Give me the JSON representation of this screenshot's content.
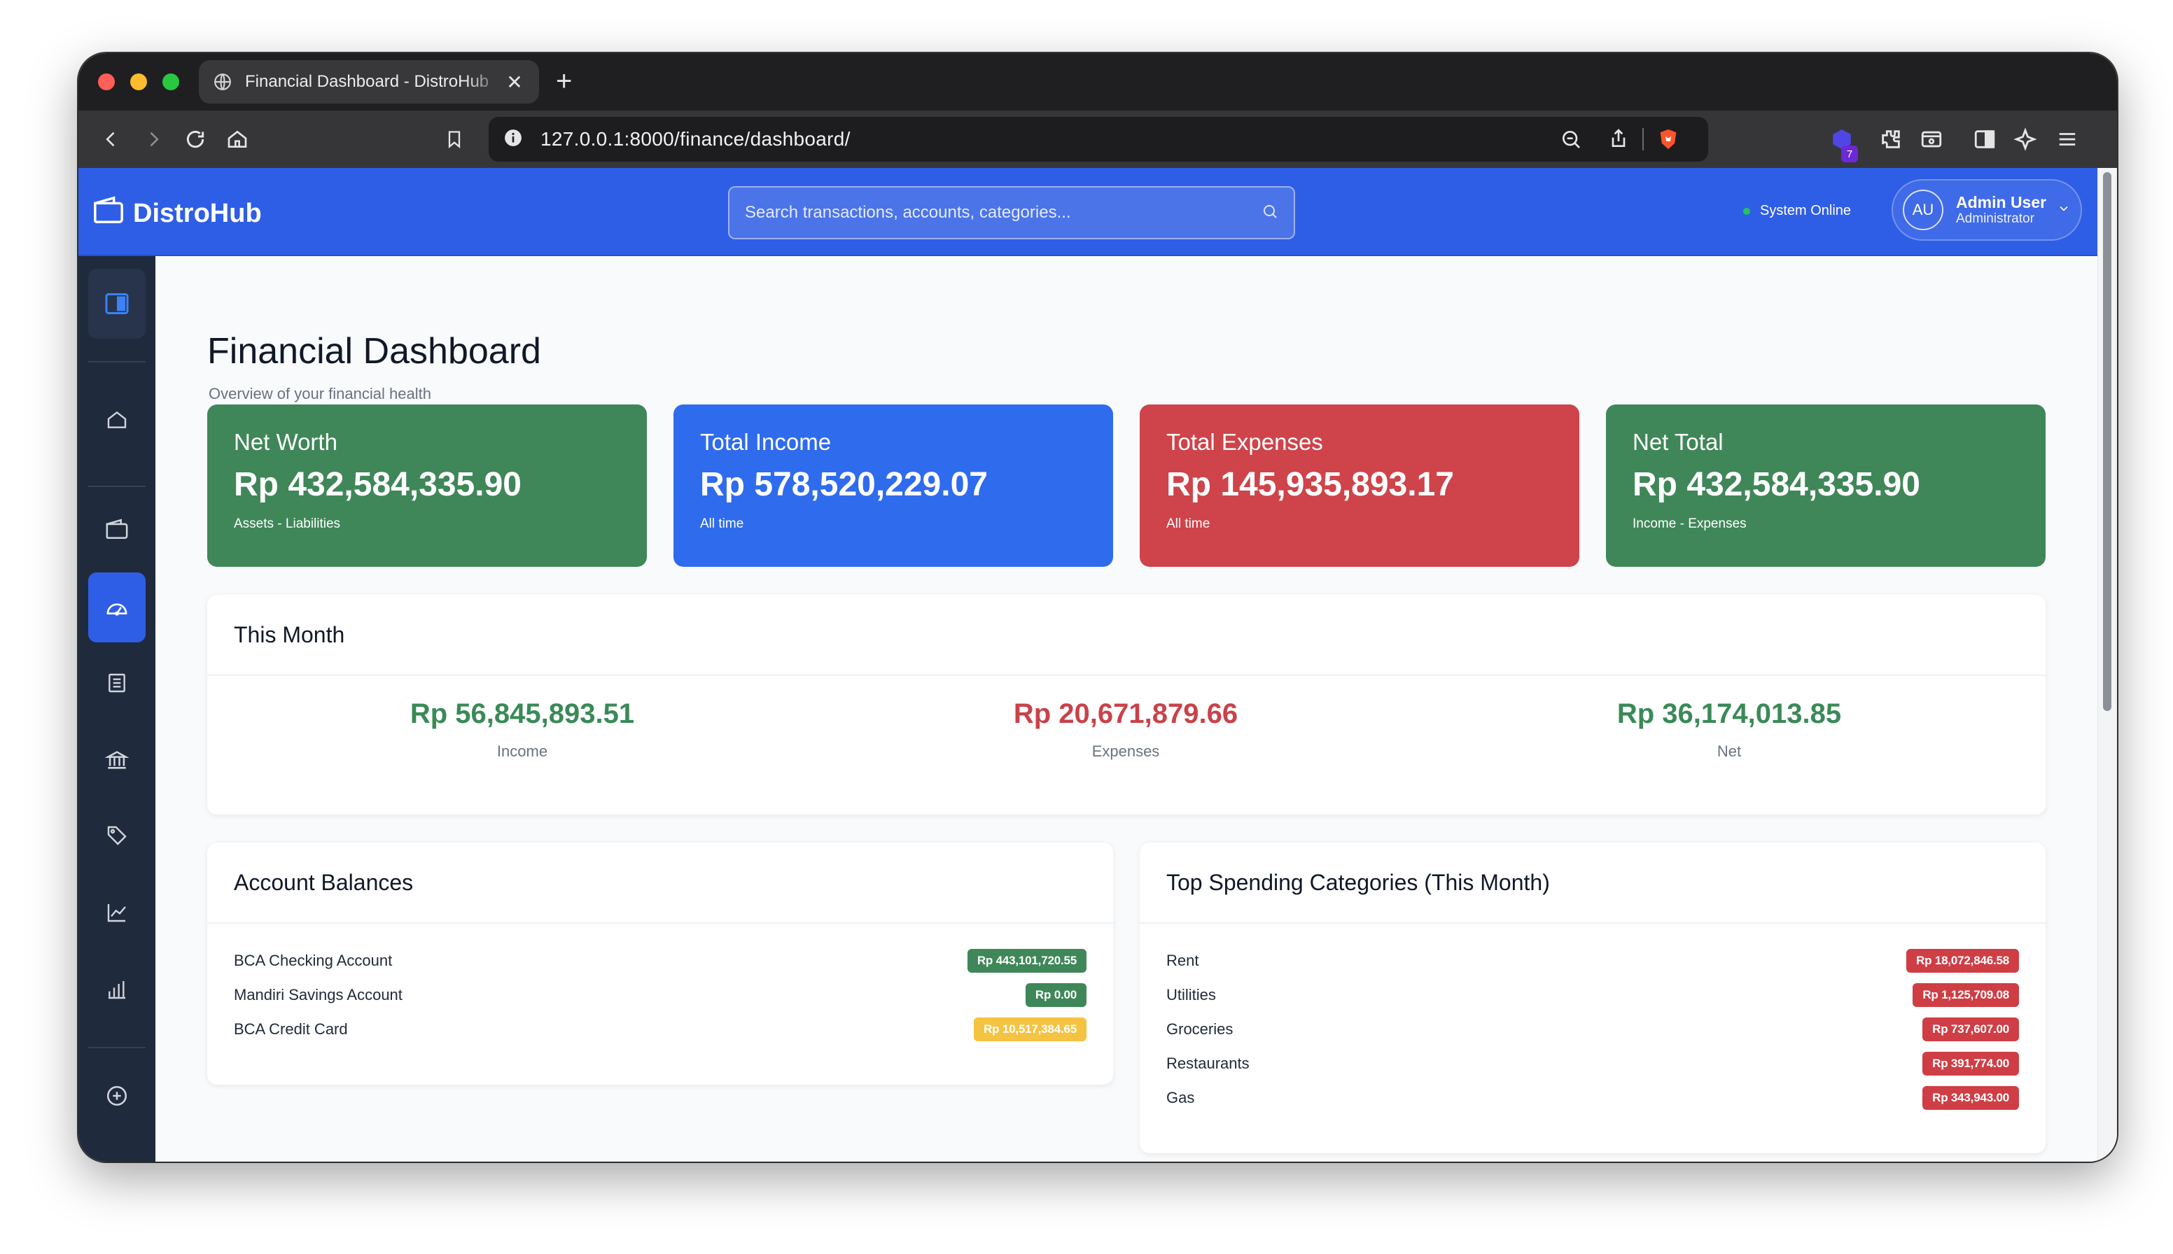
{
  "browser": {
    "tab_title": "Financial Dashboard - DistroHub",
    "url": "127.0.0.1:8000/finance/dashboard/",
    "extension_badge": "7"
  },
  "header": {
    "brand": "DistroHub",
    "search_placeholder": "Search transactions, accounts, categories...",
    "status": "System Online",
    "user": {
      "initials": "AU",
      "name": "Admin User",
      "role": "Administrator"
    }
  },
  "page": {
    "title": "Financial Dashboard",
    "subtitle": "Overview of your financial health"
  },
  "summary_cards": [
    {
      "title": "Net Worth",
      "value": "Rp 432,584,335.90",
      "subtitle": "Assets - Liabilities",
      "color": "#3f8758"
    },
    {
      "title": "Total Income",
      "value": "Rp 578,520,229.07",
      "subtitle": "All time",
      "color": "#2f6bed"
    },
    {
      "title": "Total Expenses",
      "value": "Rp 145,935,893.17",
      "subtitle": "All time",
      "color": "#cf434a"
    },
    {
      "title": "Net Total",
      "value": "Rp 432,584,335.90",
      "subtitle": "Income - Expenses",
      "color": "#3f8758"
    }
  ],
  "this_month": {
    "title": "This Month",
    "income": {
      "value": "Rp 56,845,893.51",
      "label": "Income"
    },
    "expenses": {
      "value": "Rp 20,671,879.66",
      "label": "Expenses"
    },
    "net": {
      "value": "Rp 36,174,013.85",
      "label": "Net"
    }
  },
  "account_balances": {
    "title": "Account Balances",
    "rows": [
      {
        "name": "BCA Checking Account",
        "amount": "Rp 443,101,720.55",
        "color": "#3f8758"
      },
      {
        "name": "Mandiri Savings Account",
        "amount": "Rp 0.00",
        "color": "#3f8758"
      },
      {
        "name": "BCA Credit Card",
        "amount": "Rp 10,517,384.65",
        "color": "#f5c342"
      }
    ]
  },
  "top_spending": {
    "title": "Top Spending Categories (This Month)",
    "rows": [
      {
        "name": "Rent",
        "amount": "Rp 18,072,846.58"
      },
      {
        "name": "Utilities",
        "amount": "Rp 1,125,709.08"
      },
      {
        "name": "Groceries",
        "amount": "Rp 737,607.00"
      },
      {
        "name": "Restaurants",
        "amount": "Rp 391,774.00"
      },
      {
        "name": "Gas",
        "amount": "Rp 343,943.00"
      }
    ],
    "pill_color": "#cf3e45"
  },
  "colors": {
    "positive": "#3a8a57",
    "negative": "#c9424a",
    "brand": "#2f5ee6",
    "sidebar": "#1f2a3d"
  }
}
